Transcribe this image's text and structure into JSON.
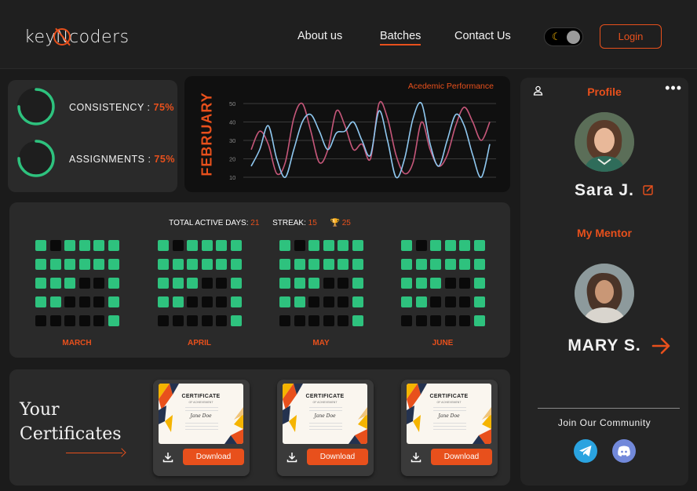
{
  "header": {
    "logo": "keyNcoders",
    "nav": [
      "About us",
      "Batches",
      "Contact Us"
    ],
    "active_nav": "Batches",
    "theme_toggle_icon": "moon-icon",
    "login_label": "Login"
  },
  "stats": {
    "items": [
      {
        "label": "CONSISTENCY :",
        "value": "75%",
        "fraction": 0.75
      },
      {
        "label": "ASSIGNMENTS :",
        "value": "75%",
        "fraction": 0.75
      }
    ]
  },
  "performance": {
    "month": "FEBRUARY",
    "title": "Acedemic Performance"
  },
  "chart_data": {
    "type": "line",
    "title": "Acedemic Performance",
    "y_ticks": [
      50,
      40,
      30,
      20,
      10
    ],
    "ylim": [
      10,
      50
    ],
    "grid": true,
    "series": [
      {
        "color": "#c6577a",
        "values": [
          25,
          35,
          28,
          12,
          18,
          42,
          50,
          35,
          18,
          25,
          46,
          38,
          25,
          28,
          20,
          50,
          42,
          22,
          12,
          18,
          40,
          25,
          16,
          22,
          38,
          48,
          40,
          30,
          40
        ]
      },
      {
        "color": "#8fc8f0",
        "values": [
          16,
          25,
          38,
          20,
          10,
          25,
          40,
          44,
          35,
          25,
          34,
          35,
          40,
          30,
          22,
          46,
          30,
          10,
          20,
          42,
          50,
          28,
          16,
          30,
          44,
          38,
          22,
          10,
          28
        ]
      }
    ]
  },
  "activity": {
    "total_label": "TOTAL ACTIVE DAYS:",
    "total_value": "21",
    "streak_label": "STREAK:",
    "streak_value": "15",
    "trophy_icon": "trophy-icon",
    "trophy_value": "25",
    "colors": {
      "active": "#2ec27e",
      "inactive": "#0a0a0a"
    },
    "months": [
      {
        "name": "MARCH",
        "rows": [
          "101111",
          "111111",
          "111001",
          "110001",
          "000001"
        ]
      },
      {
        "name": "APRIL",
        "rows": [
          "101111",
          "111111",
          "111001",
          "110001",
          "000001"
        ]
      },
      {
        "name": "MAY",
        "rows": [
          "101111",
          "111111",
          "111001",
          "110001",
          "000001"
        ]
      },
      {
        "name": "JUNE",
        "rows": [
          "101111",
          "111111",
          "111001",
          "110001",
          "000001"
        ]
      }
    ]
  },
  "certificates": {
    "title_line1": "Your",
    "title_line2": "Certificates",
    "items": [
      {
        "heading": "CERTIFICATE",
        "subheading": "OF ACHIEVEMENT",
        "recipient": "Jane Doe",
        "download_label": "Download"
      },
      {
        "heading": "CERTIFICATE",
        "subheading": "OF ACHIEVEMENT",
        "recipient": "Jane Doe",
        "download_label": "Download"
      },
      {
        "heading": "CERTIFICATE",
        "subheading": "OF ACHIEVEMENT",
        "recipient": "Jane Doe",
        "download_label": "Download"
      }
    ]
  },
  "profile": {
    "title": "Profile",
    "name": "Sara J.",
    "mentor_title": "My Mentor",
    "mentor_name": "MARY S.",
    "community_label": "Join Our Community",
    "social_icons": [
      "telegram-icon",
      "discord-icon"
    ],
    "accent": "#e8501c"
  }
}
